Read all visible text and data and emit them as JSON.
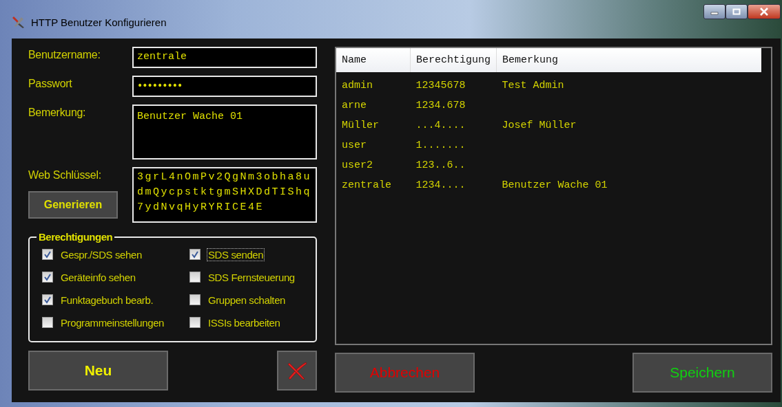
{
  "window": {
    "title": "HTTP Benutzer Konfigurieren"
  },
  "form": {
    "username_label": "Benutzername:",
    "username": "zentrale",
    "password_label": "Passwort",
    "password": "•••••••••",
    "remark_label": "Bemerkung:",
    "remark": "Benutzer Wache 01",
    "webkey_label": "Web Schlüssel:",
    "webkey": "3grL4nOmPv2QgNm3obha8udmQycpstktgmSHXDdTIShq7ydNvqHyRYRICE4E",
    "generate_button": "Generieren"
  },
  "permissions": {
    "title": "Berechtigungen",
    "items": [
      {
        "label": "Gespr./SDS sehen",
        "checked": true,
        "focused": false
      },
      {
        "label": "SDS senden",
        "checked": true,
        "focused": true
      },
      {
        "label": "Geräteinfo sehen",
        "checked": true,
        "focused": false
      },
      {
        "label": "SDS Fernsteuerung",
        "checked": false,
        "focused": false
      },
      {
        "label": "Funktagebuch bearb.",
        "checked": true,
        "focused": false
      },
      {
        "label": "Gruppen schalten",
        "checked": false,
        "focused": false
      },
      {
        "label": "Programmeinstellungen",
        "checked": false,
        "focused": false
      },
      {
        "label": "ISSIs bearbeiten",
        "checked": false,
        "focused": false
      }
    ]
  },
  "table": {
    "columns": [
      "Name",
      "Berechtigung",
      "Bemerkung"
    ],
    "rows": [
      [
        "admin",
        "12345678",
        "Test Admin"
      ],
      [
        "arne",
        "1234.678",
        ""
      ],
      [
        "Müller",
        "...4....",
        "Josef Müller"
      ],
      [
        "user",
        "1.......",
        ""
      ],
      [
        "user2",
        "123..6..",
        ""
      ],
      [
        "zentrale",
        "1234....",
        "Benutzer Wache 01"
      ]
    ]
  },
  "buttons": {
    "new": "Neu",
    "cancel": "Abbrechen",
    "save": "Speichern"
  }
}
